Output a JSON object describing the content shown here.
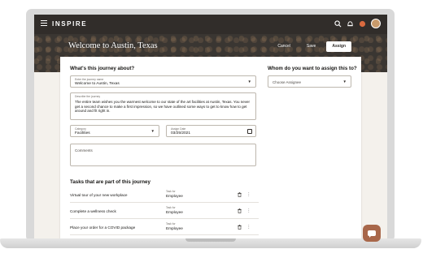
{
  "app": {
    "brand": "INSPIRE"
  },
  "header": {
    "title": "Welcome to Austin, Texas",
    "cancel_label": "Cancel",
    "save_label": "Save",
    "assign_label": "Assign"
  },
  "form": {
    "section_title": "What's this journey about?",
    "journey_name": {
      "label": "Enter the journey name",
      "value": "Welcome to Austin, Texas"
    },
    "description": {
      "label": "Describe the journey",
      "value": "The entire team wishes you the warmest welcome to our state of the art facilities at Austin, Texas. You never get a second chance to make a first impression, so we have outlined some ways to get to know how to get around and fit right in."
    },
    "category": {
      "label": "Category",
      "value": "Facilities"
    },
    "assign_date": {
      "label": "Assign Date",
      "value": "03/25/2021"
    },
    "comments": {
      "placeholder": "Comments"
    }
  },
  "assignee": {
    "section_title": "Whom do you want to assign this to?",
    "select_placeholder": "Choose Assignee"
  },
  "tasks": {
    "section_title": "Tasks that are part of this journey",
    "items": [
      {
        "name": "Virtual tour of your new workplace",
        "type_label": "Task for",
        "type": "Employee"
      },
      {
        "name": "Complete a wellness check",
        "type_label": "Task for",
        "type": "Employee"
      },
      {
        "name": "Place your order for a COVID package",
        "type_label": "Task for",
        "type": "Employee"
      }
    ]
  },
  "icons": [
    "menu-icon",
    "search-icon",
    "bell-icon",
    "notification-badge-icon",
    "avatar",
    "dropdown-caret-icon",
    "calendar-icon",
    "trash-icon",
    "more-vertical-icon",
    "chat-icon"
  ],
  "colors": {
    "topbar": "#312d2a",
    "accent": "#a8674a",
    "primary_button_bg": "#ffffff"
  }
}
